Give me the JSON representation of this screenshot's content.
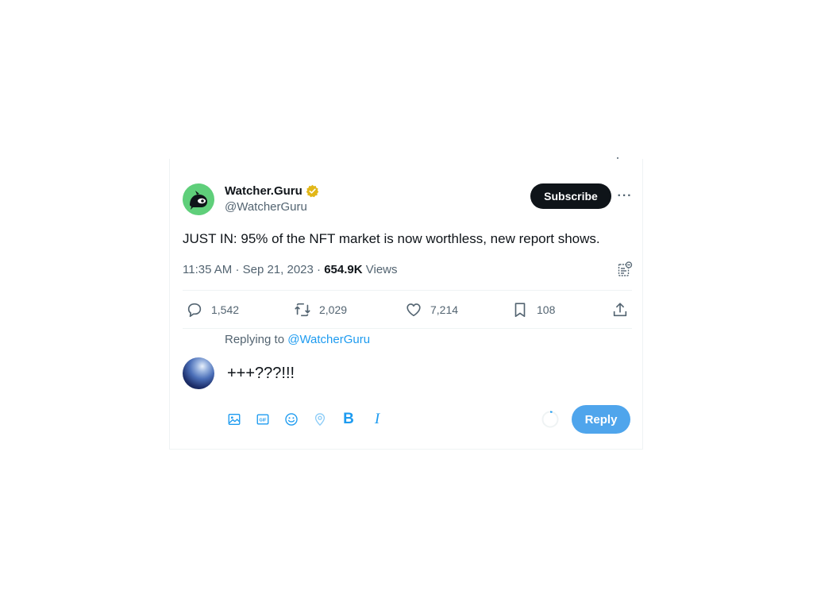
{
  "tweet": {
    "author_name": "Watcher.Guru",
    "author_handle": "@WatcherGuru",
    "subscribe_label": "Subscribe",
    "more_label": "···",
    "text": "JUST IN: 95% of the NFT market is now worthless, new report shows.",
    "time": "11:35 AM",
    "separator": "·",
    "date": "Sep 21, 2023",
    "views_count": "654.9K",
    "views_label": "Views"
  },
  "actions": {
    "replies": "1,542",
    "retweets": "2,029",
    "likes": "7,214",
    "bookmarks": "108"
  },
  "reply": {
    "replying_prefix": "Replying to",
    "replying_mention": "@WatcherGuru",
    "draft_text": "+++???!!!",
    "button_label": "Reply"
  },
  "colors": {
    "accent": "#1d9bf0",
    "reply_button": "#4fa5ec",
    "subscribe_bg": "#0f1419",
    "avatar_bg": "#5fcf7a",
    "verified_gold": "#e2b719",
    "muted_text": "#536471"
  },
  "icons": {
    "reply": "speech-bubble-icon",
    "retweet": "retweet-icon",
    "like": "heart-icon",
    "bookmark": "bookmark-icon",
    "share": "upload-share-icon",
    "analytics": "analytics-icon",
    "verified": "verified-badge-icon",
    "composer_tools": [
      "image-icon",
      "gif-icon",
      "emoji-icon",
      "location-icon",
      "bold-icon",
      "italic-icon"
    ]
  }
}
